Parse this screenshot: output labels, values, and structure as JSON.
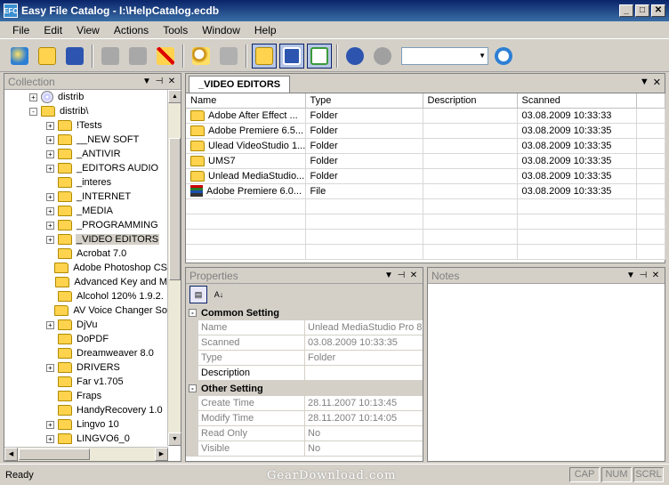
{
  "window": {
    "title": "Easy File Catalog - I:\\HelpCatalog.ecdb",
    "app_icon": "EFC",
    "minimize": "_",
    "maximize": "□",
    "close": "✕"
  },
  "menu": [
    "File",
    "Edit",
    "View",
    "Actions",
    "Tools",
    "Window",
    "Help"
  ],
  "toolbar": {
    "search_value": "",
    "icons": [
      "new-catalog-icon",
      "open-icon",
      "save-icon",
      "add-disk-icon",
      "add-folder-icon",
      "delete-icon",
      "find-icon",
      "rename-icon",
      "browse-icon",
      "info-panel-icon",
      "notes-icon",
      "info-icon",
      "help-icon",
      "search-icon"
    ]
  },
  "collection": {
    "title": "Collection",
    "items": [
      {
        "label": "distrib",
        "type": "disc",
        "expander": "+",
        "indent": 0
      },
      {
        "label": "distrib\\",
        "type": "folder",
        "expander": "-",
        "indent": 0
      },
      {
        "label": "!Tests",
        "type": "folder",
        "expander": "+",
        "indent": 1
      },
      {
        "label": "__NEW SOFT",
        "type": "folder",
        "expander": "+",
        "indent": 1
      },
      {
        "label": "_ANTIVIR",
        "type": "folder",
        "expander": "+",
        "indent": 1
      },
      {
        "label": "_EDITORS AUDIO",
        "type": "folder",
        "expander": "+",
        "indent": 1
      },
      {
        "label": "_interes",
        "type": "folder",
        "expander": "",
        "indent": 1
      },
      {
        "label": "_INTERNET",
        "type": "folder",
        "expander": "+",
        "indent": 1
      },
      {
        "label": "_MEDIA",
        "type": "folder",
        "expander": "+",
        "indent": 1
      },
      {
        "label": "_PROGRAMMING",
        "type": "folder",
        "expander": "+",
        "indent": 1
      },
      {
        "label": "_VIDEO EDITORS",
        "type": "folder",
        "expander": "+",
        "indent": 1,
        "selected": true
      },
      {
        "label": "Acrobat 7.0",
        "type": "folder",
        "expander": "",
        "indent": 1
      },
      {
        "label": "Adobe Photoshop CS",
        "type": "folder",
        "expander": "",
        "indent": 1
      },
      {
        "label": "Advanced Key and M",
        "type": "folder",
        "expander": "",
        "indent": 1
      },
      {
        "label": "Alcohol 120% 1.9.2.",
        "type": "folder",
        "expander": "",
        "indent": 1
      },
      {
        "label": "AV Voice Changer So",
        "type": "folder",
        "expander": "",
        "indent": 1
      },
      {
        "label": "DjVu",
        "type": "folder",
        "expander": "+",
        "indent": 1
      },
      {
        "label": "DoPDF",
        "type": "folder",
        "expander": "",
        "indent": 1
      },
      {
        "label": "Dreamweaver 8.0",
        "type": "folder",
        "expander": "",
        "indent": 1
      },
      {
        "label": "DRIVERS",
        "type": "folder",
        "expander": "+",
        "indent": 1
      },
      {
        "label": "Far v1.705",
        "type": "folder",
        "expander": "",
        "indent": 1
      },
      {
        "label": "Fraps",
        "type": "folder",
        "expander": "",
        "indent": 1
      },
      {
        "label": "HandyRecovery 1.0",
        "type": "folder",
        "expander": "",
        "indent": 1
      },
      {
        "label": "Lingvo 10",
        "type": "folder",
        "expander": "+",
        "indent": 1
      },
      {
        "label": "LINGVO6_0",
        "type": "folder",
        "expander": "+",
        "indent": 1
      }
    ]
  },
  "file_panel": {
    "tab": "_VIDEO EDITORS",
    "columns": [
      "Name",
      "Type",
      "Description",
      "Scanned"
    ],
    "rows": [
      {
        "name": "Adobe After Effect ...",
        "type": "Folder",
        "description": "",
        "scanned": "03.08.2009 10:33:33",
        "icon": "folder"
      },
      {
        "name": "Adobe Premiere 6.5...",
        "type": "Folder",
        "description": "",
        "scanned": "03.08.2009 10:33:35",
        "icon": "folder"
      },
      {
        "name": "Ulead VideoStudio 1...",
        "type": "Folder",
        "description": "",
        "scanned": "03.08.2009 10:33:35",
        "icon": "folder"
      },
      {
        "name": "UMS7",
        "type": "Folder",
        "description": "",
        "scanned": "03.08.2009 10:33:35",
        "icon": "folder"
      },
      {
        "name": "Unlead MediaStudio...",
        "type": "Folder",
        "description": "",
        "scanned": "03.08.2009 10:33:35",
        "icon": "folder"
      },
      {
        "name": "Adobe Premiere 6.0...",
        "type": "File",
        "description": "",
        "scanned": "03.08.2009 10:33:35",
        "icon": "file"
      }
    ]
  },
  "properties": {
    "title": "Properties",
    "sort_category_label": "▤",
    "sort_alpha_label": "A↓",
    "categories": [
      {
        "name": "Common Setting",
        "rows": [
          {
            "name": "Name",
            "value": "Unlead MediaStudio Pro 8",
            "dark": false
          },
          {
            "name": "Scanned",
            "value": "03.08.2009 10:33:35",
            "dark": false
          },
          {
            "name": "Type",
            "value": "Folder",
            "dark": false
          },
          {
            "name": "Description",
            "value": "",
            "dark": true
          }
        ]
      },
      {
        "name": "Other Setting",
        "rows": [
          {
            "name": "Create Time",
            "value": "28.11.2007 10:13:45",
            "dark": false
          },
          {
            "name": "Modify Time",
            "value": "28.11.2007 10:14:05",
            "dark": false
          },
          {
            "name": "Read Only",
            "value": "No",
            "dark": false
          },
          {
            "name": "Visible",
            "value": "No",
            "dark": false
          }
        ]
      }
    ]
  },
  "notes": {
    "title": "Notes"
  },
  "status": {
    "text": "Ready",
    "indicators": [
      "CAP",
      "NUM",
      "SCRL"
    ]
  },
  "watermark": "GearDownload.com",
  "colors": {
    "title_bar": "#0a246a",
    "folder": "#ffd34d",
    "panel": "#d4d0c8"
  }
}
